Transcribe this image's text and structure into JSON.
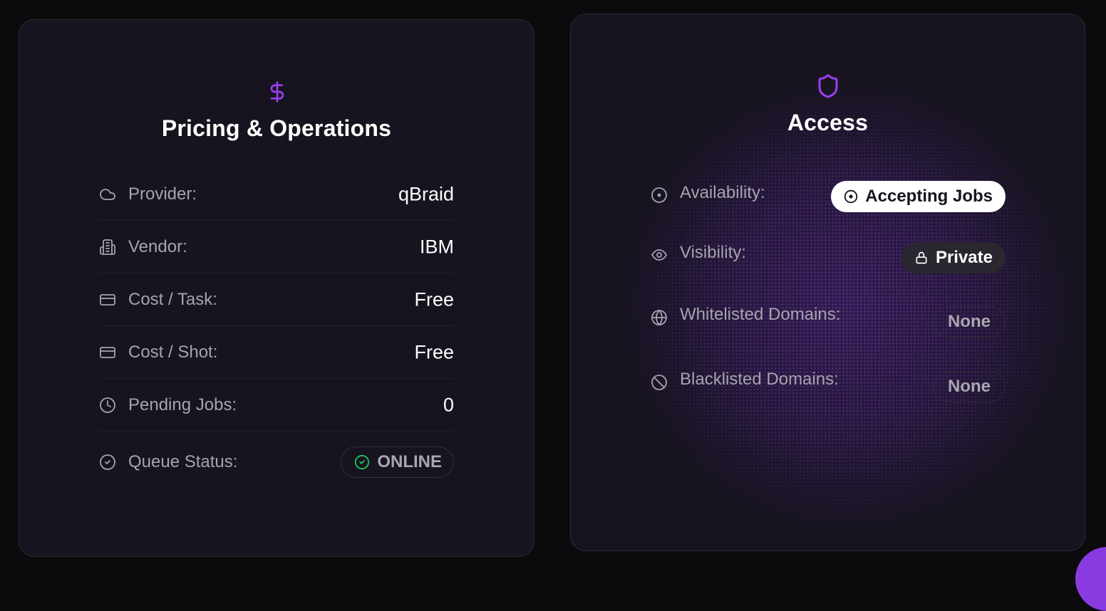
{
  "pricing": {
    "title": "Pricing & Operations",
    "icon": "dollar-icon",
    "rows": [
      {
        "icon": "cloud-icon",
        "label": "Provider:",
        "value": "qBraid"
      },
      {
        "icon": "building-icon",
        "label": "Vendor:",
        "value": "IBM"
      },
      {
        "icon": "credit-card-icon",
        "label": "Cost / Task:",
        "value": "Free"
      },
      {
        "icon": "credit-card-icon",
        "label": "Cost / Shot:",
        "value": "Free"
      },
      {
        "icon": "clock-icon",
        "label": "Pending Jobs:",
        "value": "0"
      },
      {
        "icon": "check-circle-icon",
        "label": "Queue Status:",
        "value": "ONLINE"
      }
    ]
  },
  "access": {
    "title": "Access",
    "icon": "shield-icon",
    "rows": [
      {
        "icon": "target-icon",
        "label": "Availability:",
        "value": "Accepting Jobs"
      },
      {
        "icon": "eye-icon",
        "label": "Visibility:",
        "value": "Private"
      },
      {
        "icon": "globe-icon",
        "label": "Whitelisted Domains:",
        "value": "None"
      },
      {
        "icon": "ban-icon",
        "label": "Blacklisted Domains:",
        "value": "None"
      }
    ]
  },
  "colors": {
    "accent": "#9b3ff0",
    "online": "#22c55e",
    "background": "#0b0a0d",
    "card": "#17141f"
  }
}
